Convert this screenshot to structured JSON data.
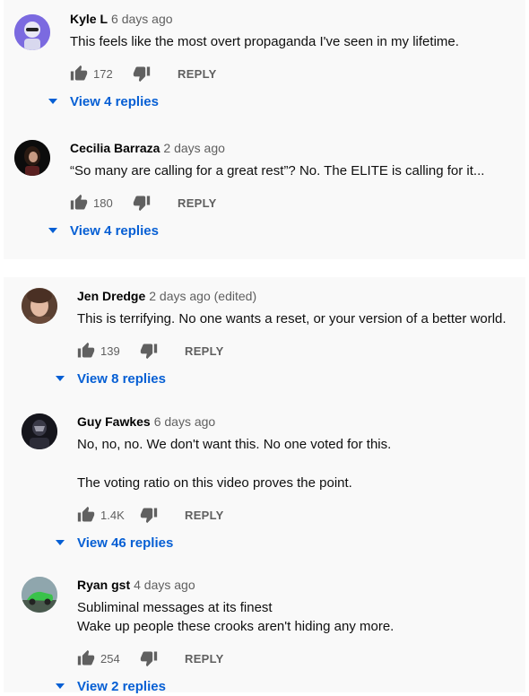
{
  "comments": [
    {
      "author": "Kyle L",
      "time": "6 days ago",
      "lines": [
        "This feels like the most overt propaganda I've seen in my lifetime."
      ],
      "likes": "172",
      "reply_label": "REPLY",
      "replies_label": "View 4 replies"
    },
    {
      "author": "Cecilia Barraza",
      "time": "2 days ago",
      "lines": [
        "“So many are calling for a great rest”? No. The ELITE is calling for it..."
      ],
      "likes": "180",
      "reply_label": "REPLY",
      "replies_label": "View 4 replies"
    },
    {
      "author": "Jen Dredge",
      "time": "2 days ago (edited)",
      "lines": [
        "This is terrifying. No one wants a reset, or your version of a better world."
      ],
      "likes": "139",
      "reply_label": "REPLY",
      "replies_label": "View 8 replies"
    },
    {
      "author": "Guy Fawkes",
      "time": "6 days ago",
      "lines": [
        "No, no, no. We don't want this. No one voted for this.",
        "The voting ratio on this video proves the point."
      ],
      "likes": "1.4K",
      "reply_label": "REPLY",
      "replies_label": "View 46 replies"
    },
    {
      "author": "Ryan gst",
      "time": "4 days ago",
      "lines": [
        "Subliminal messages at its finest",
        "Wake up people these crooks aren't hiding any more."
      ],
      "likes": "254",
      "reply_label": "REPLY",
      "replies_label": "View 2 replies"
    }
  ],
  "icons": {
    "like": "thumbs-up-icon",
    "dislike": "thumbs-down-icon",
    "expand": "caret-down-icon"
  },
  "colors": {
    "link_blue": "#065fd4",
    "secondary_text": "#606060",
    "panel_bg": "#f9f9f9"
  }
}
